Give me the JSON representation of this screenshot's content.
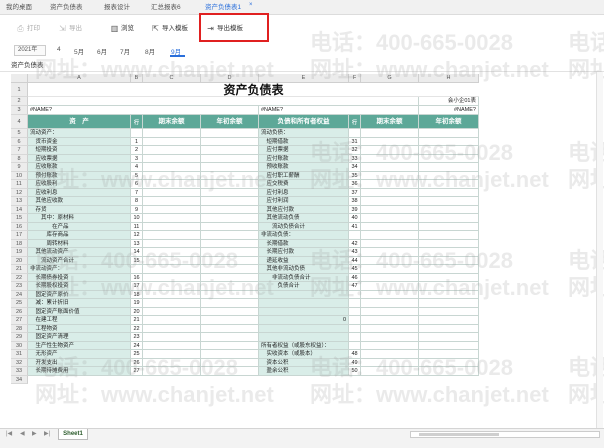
{
  "tabs": [
    {
      "label": "我的桌面",
      "active": false
    },
    {
      "label": "资产负债表",
      "active": false
    },
    {
      "label": "报表设计",
      "active": false
    },
    {
      "label": "汇总报表6",
      "active": false
    },
    {
      "label": "资产负债表1",
      "active": true
    }
  ],
  "tab_close": "×",
  "toolbar": {
    "print": "打印",
    "export": "导出",
    "preview": "浏览",
    "import_template": "导入模板",
    "export_template": "导出模板"
  },
  "year": "2021年",
  "months": [
    "4",
    "5月",
    "6月",
    "7月",
    "8月",
    "9月"
  ],
  "active_month": "9月",
  "sheet_label": "资产负债表",
  "sheet_tab": "Sheet1",
  "watermark": {
    "phone": "电话：400-665-0028",
    "url": "网址：www.chanjet.net",
    "phone_short": "电话",
    "url_short": "网址"
  },
  "chart_data": {
    "type": "table",
    "title": "资产负债表",
    "column_letters": [
      "A",
      "B",
      "C",
      "D",
      "E",
      "F",
      "G",
      "H"
    ],
    "row_numbers": [
      "1",
      "2",
      "3",
      "4",
      "5",
      "6",
      "7",
      "8",
      "9",
      "10",
      "11",
      "12",
      "13",
      "14",
      "15",
      "16",
      "17",
      "18",
      "19",
      "20",
      "21",
      "22",
      "23",
      "24",
      "25",
      "26",
      "27",
      "28",
      "29",
      "30",
      "31",
      "32",
      "33",
      "34"
    ],
    "form_code": "会小企01表",
    "name_error": "#NAME?",
    "headers": {
      "asset": "资　产",
      "line": "行次",
      "end_balance": "期末余额",
      "begin_balance": "年初余额",
      "liability": "负债和所有者权益"
    },
    "rows": [
      {
        "a": "流动资产：",
        "b": "",
        "e": "流动负债：",
        "f": ""
      },
      {
        "a": "　货币资金",
        "b": "1",
        "e": "　短期借款",
        "f": "31"
      },
      {
        "a": "　短期投资",
        "b": "2",
        "e": "　应付票据",
        "f": "32"
      },
      {
        "a": "　应收票据",
        "b": "3",
        "e": "　应付账款",
        "f": "33"
      },
      {
        "a": "　应收账款",
        "b": "4",
        "e": "　预收账款",
        "f": "34"
      },
      {
        "a": "　预付账款",
        "b": "5",
        "e": "　应付职工薪酬",
        "f": "35"
      },
      {
        "a": "　应收股利",
        "b": "6",
        "e": "　应交税费",
        "f": "36"
      },
      {
        "a": "　应收利息",
        "b": "7",
        "e": "　应付利息",
        "f": "37"
      },
      {
        "a": "　其他应收款",
        "b": "8",
        "e": "　应付利润",
        "f": "38"
      },
      {
        "a": "　存货",
        "b": "9",
        "e": "　其他应付款",
        "f": "39"
      },
      {
        "a": "　　其中：原材料",
        "b": "10",
        "e": "　其他流动负债",
        "f": "40"
      },
      {
        "a": "　　　　在产品",
        "b": "11",
        "e": "　　流动负债合计",
        "f": "41"
      },
      {
        "a": "　　　库存商品",
        "b": "12",
        "e": "非流动负债：",
        "f": ""
      },
      {
        "a": "　　　周转材料",
        "b": "13",
        "e": "　长期借款",
        "f": "42"
      },
      {
        "a": "　其他流动资产",
        "b": "14",
        "e": "　长期应付款",
        "f": "43"
      },
      {
        "a": "　　流动资产合计",
        "b": "15",
        "e": "　递延收益",
        "f": "44"
      },
      {
        "a": "非流动资产：",
        "b": "",
        "e": "　其他非流动负债",
        "f": "45"
      },
      {
        "a": "　长期债券投资",
        "b": "16",
        "e": "　　非流动负债合计",
        "f": "46"
      },
      {
        "a": "　长期股权投资",
        "b": "17",
        "e": "　　　负债合计",
        "f": "47"
      },
      {
        "a": "　固定资产原价",
        "b": "18",
        "e": "",
        "f": ""
      },
      {
        "a": "　减：累计折旧",
        "b": "19",
        "e": "",
        "f": ""
      },
      {
        "a": "　固定资产账面价值",
        "b": "20",
        "e": "",
        "f": ""
      },
      {
        "a": "　在建工程",
        "b": "21",
        "e": "",
        "f": "",
        "e_value": "0"
      },
      {
        "a": "　工程物资",
        "b": "22",
        "e": "",
        "f": ""
      },
      {
        "a": "　固定资产清理",
        "b": "23",
        "e": "",
        "f": ""
      },
      {
        "a": "　生产性生物资产",
        "b": "24",
        "e": "所有者权益（或股东权益）：",
        "f": ""
      },
      {
        "a": "　无形资产",
        "b": "25",
        "e": "　实收资本（或股本）",
        "f": "48"
      },
      {
        "a": "　开发支出",
        "b": "26",
        "e": "　资本公积",
        "f": "49"
      },
      {
        "a": "　长期待摊费用",
        "b": "27",
        "e": "　盈余公积",
        "f": "50"
      }
    ]
  }
}
